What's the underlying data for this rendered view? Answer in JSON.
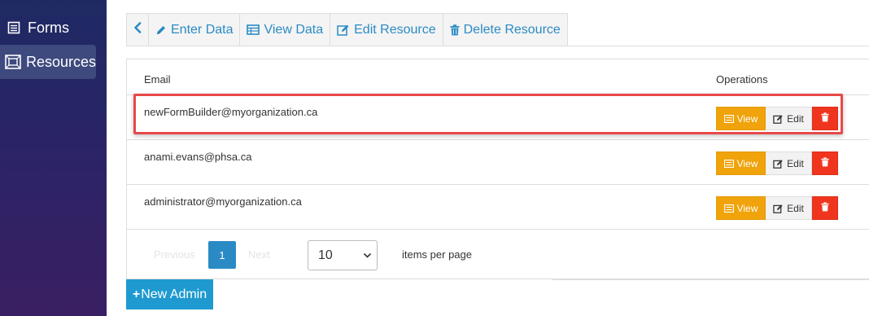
{
  "sidebar": {
    "items": [
      {
        "label": "Forms",
        "icon": "list-icon"
      },
      {
        "label": "Resources",
        "icon": "resource-icon",
        "active": true
      }
    ]
  },
  "tabs": {
    "back_icon": "chevron-left-icon",
    "items": [
      {
        "label": "Enter Data",
        "icon": "pencil-icon"
      },
      {
        "label": "View Data",
        "icon": "table-icon"
      },
      {
        "label": "Edit Resource",
        "icon": "edit-icon"
      },
      {
        "label": "Delete Resource",
        "icon": "trash-icon"
      }
    ]
  },
  "table": {
    "columns": [
      "Email",
      "Operations"
    ],
    "rows": [
      {
        "email": "newFormBuilder@myorganization.ca"
      },
      {
        "email": "anami.evans@phsa.ca"
      },
      {
        "email": "administrator@myorganization.ca"
      }
    ],
    "actions": {
      "view": "View",
      "edit": "Edit"
    }
  },
  "pagination": {
    "previous": "Previous",
    "current": "1",
    "next": "Next",
    "per_page_value": "10",
    "per_page_label": "items per page"
  },
  "new_admin": {
    "plus": "+",
    "label": "New Admin"
  },
  "colors": {
    "accent": "#2a8bc4",
    "view": "#f0a30a",
    "delete": "#f0351f",
    "highlight": "#e8484a",
    "primary_button": "#1e9ad0"
  }
}
